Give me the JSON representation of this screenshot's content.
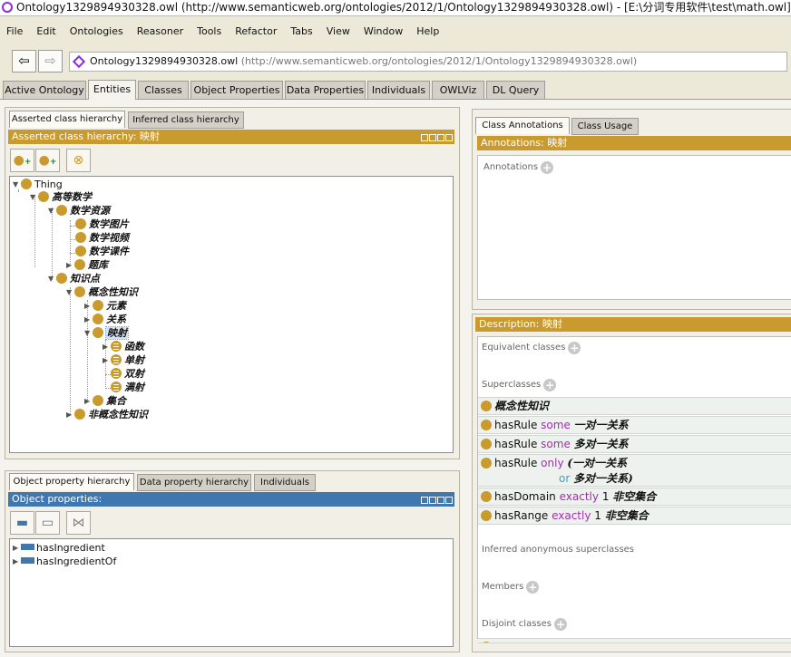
{
  "window": {
    "title": "Ontology1329894930328.owl (http://www.semanticweb.org/ontologies/2012/1/Ontology1329894930328.owl) - [E:\\分词专用软件\\test\\math.owl]"
  },
  "menu": [
    "File",
    "Edit",
    "Ontologies",
    "Reasoner",
    "Tools",
    "Refactor",
    "Tabs",
    "View",
    "Window",
    "Help"
  ],
  "nav": {
    "back_icon": "arrow-left",
    "forward_icon": "arrow-right"
  },
  "address": {
    "ontology_name": "Ontology1329894930328.owl",
    "ontology_iri": "(http://www.semanticweb.org/ontologies/2012/1/Ontology1329894930328.owl)"
  },
  "main_tabs": [
    "Active Ontology",
    "Entities",
    "Classes",
    "Object Properties",
    "Data Properties",
    "Individuals",
    "OWLViz",
    "DL Query"
  ],
  "main_tabs_active": "Entities",
  "class_panel": {
    "tabs": [
      "Asserted class hierarchy",
      "Inferred class hierarchy"
    ],
    "header": "Asserted class hierarchy: 映射",
    "toolbar_icons": [
      "add-subclass",
      "add-sibling",
      "delete-class"
    ],
    "tree": {
      "root": "Thing",
      "l1": "高等数学",
      "l2a": "数学资源",
      "l3a": [
        "数学图片",
        "数学视频",
        "数学课件",
        "题库"
      ],
      "l2b": "知识点",
      "l3b": "概念性知识",
      "l4": [
        "元素",
        "关系",
        "映射"
      ],
      "l5": [
        "函数",
        "单射",
        "双射",
        "满射"
      ],
      "l4_last": "集合",
      "l3c": "非概念性知识"
    }
  },
  "prop_panel": {
    "tabs": [
      "Object property hierarchy",
      "Data property hierarchy",
      "Individuals"
    ],
    "header": "Object properties:",
    "toolbar_icons": [
      "add-subproperty",
      "add-sibling-property",
      "delete-property"
    ],
    "items": [
      "hasIngredient",
      "hasIngredientOf"
    ]
  },
  "annotations_panel": {
    "tabs": [
      "Class Annotations",
      "Class Usage"
    ],
    "header": "Annotations: 映射",
    "annotations_label": "Annotations"
  },
  "description_panel": {
    "header": "Description: 映射",
    "equivalent_label": "Equivalent classes",
    "superclasses_label": "Superclasses",
    "superclasses": [
      {
        "name": "概念性知识"
      },
      {
        "prop": "hasRule",
        "kw": "some",
        "filler": "一对一关系"
      },
      {
        "prop": "hasRule",
        "kw": "some",
        "filler": "多对一关系"
      },
      {
        "prop": "hasRule",
        "kw": "only",
        "filler": "(一对一关系",
        "kw2": "or",
        "filler2": "多对一关系)"
      },
      {
        "prop": "hasDomain",
        "kw": "exactly",
        "n": "1",
        "filler": "非空集合"
      },
      {
        "prop": "hasRange",
        "kw": "exactly",
        "n": "1",
        "filler": "非空集合"
      }
    ],
    "inferred_label": "Inferred anonymous superclasses",
    "members_label": "Members",
    "disjoint_label": "Disjoint classes"
  }
}
